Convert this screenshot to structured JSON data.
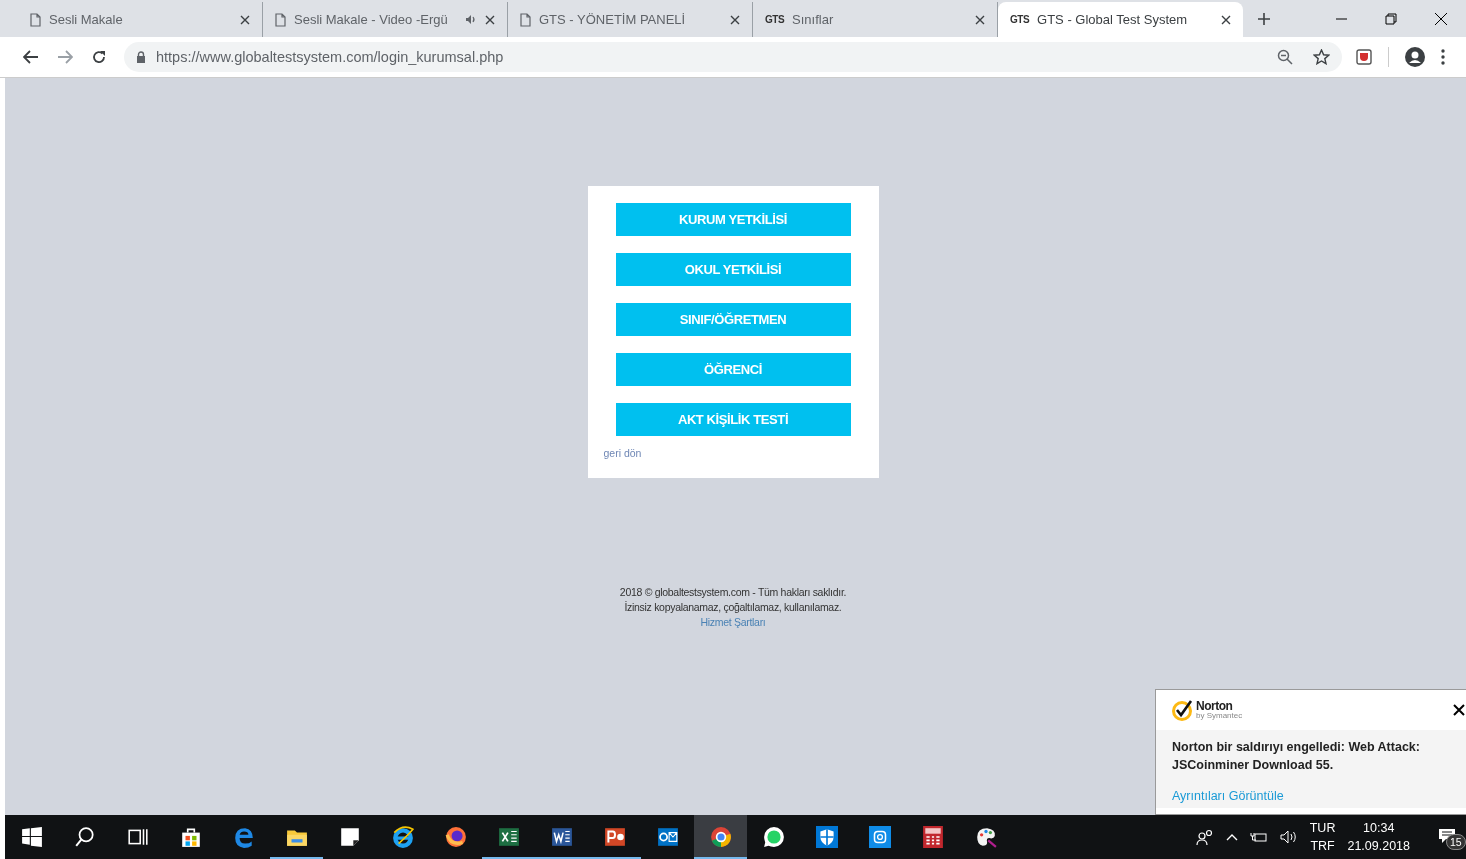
{
  "tabs": [
    {
      "title": "Sesli Makale",
      "kind": "page",
      "audio": false,
      "selected": false
    },
    {
      "title": "Sesli Makale - Video -Ergü",
      "kind": "page",
      "audio": true,
      "selected": false
    },
    {
      "title": "GTS - YÖNETİM PANELİ",
      "kind": "page",
      "audio": false,
      "selected": false
    },
    {
      "title": "Sınıflar",
      "kind": "text",
      "favicon_text": "GTS",
      "audio": false,
      "selected": false
    },
    {
      "title": "GTS - Global Test System",
      "kind": "text",
      "favicon_text": "GTS",
      "audio": false,
      "selected": true
    }
  ],
  "address_bar": {
    "url": "https://www.globaltestsystem.com/login_kurumsal.php"
  },
  "login_card": {
    "buttons": [
      "KURUM YETKİLİSİ",
      "OKUL YETKİLİSİ",
      "SINIF/ÖĞRETMEN",
      "ÖĞRENCİ",
      "AKT KİŞİLİK TESTİ"
    ],
    "back_link": "geri dön"
  },
  "footer": {
    "lines": [
      "2018 © globaltestsystem.com - Tüm hakları saklıdır.",
      "İzinsiz kopyalanamaz, çoğaltılamaz, kullanılamaz."
    ],
    "link": "Hizmet Şartları"
  },
  "notification": {
    "brand": "Norton",
    "brand_sub": "by Symantec",
    "message": "Norton bir saldırıyı engelledi: Web Attack: JSCoinminer Download 55.",
    "link": "Ayrıntıları Görüntüle"
  },
  "taskbar": {
    "apps": [
      {
        "kind": "start",
        "running": false,
        "selected": false
      },
      {
        "kind": "search",
        "running": false,
        "selected": false
      },
      {
        "kind": "taskview",
        "running": false,
        "selected": false
      },
      {
        "kind": "store",
        "running": false,
        "selected": false
      },
      {
        "kind": "edge",
        "running": false,
        "selected": false
      },
      {
        "kind": "explorer",
        "running": true,
        "selected": false
      },
      {
        "kind": "sticky",
        "running": false,
        "selected": false
      },
      {
        "kind": "ie",
        "running": false,
        "selected": false
      },
      {
        "kind": "firefox",
        "running": false,
        "selected": false
      },
      {
        "kind": "excel",
        "running": true,
        "selected": false
      },
      {
        "kind": "word",
        "running": true,
        "selected": false
      },
      {
        "kind": "powerpoint",
        "running": true,
        "selected": false
      },
      {
        "kind": "outlook",
        "running": false,
        "selected": false
      },
      {
        "kind": "chrome",
        "running": true,
        "selected": true
      },
      {
        "kind": "whatsapp",
        "running": false,
        "selected": false
      },
      {
        "kind": "shield",
        "running": false,
        "selected": false
      },
      {
        "kind": "camera",
        "running": false,
        "selected": false
      },
      {
        "kind": "calculator",
        "running": false,
        "selected": false
      },
      {
        "kind": "paint",
        "running": false,
        "selected": false
      }
    ],
    "tray": {
      "language": [
        "TUR",
        "TRF"
      ],
      "time": "10:34",
      "date": "21.09.2018",
      "notification_count": "15"
    }
  }
}
